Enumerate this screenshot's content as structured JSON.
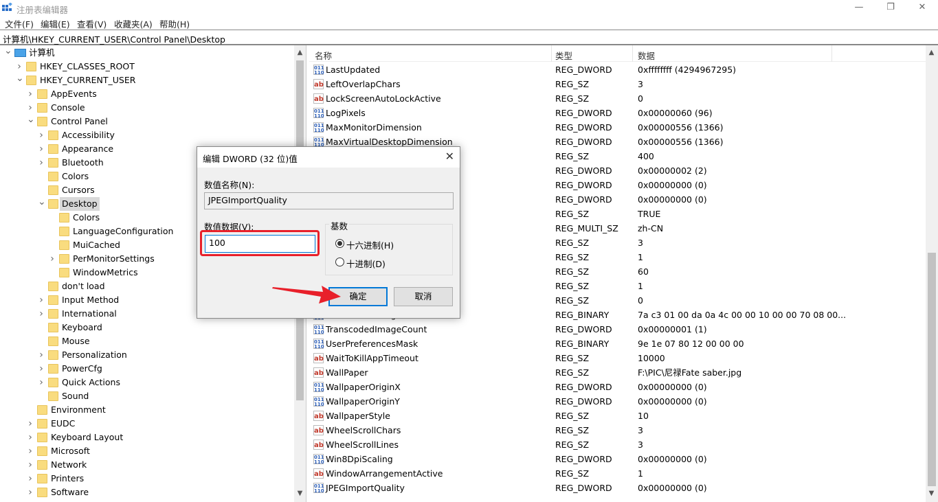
{
  "window": {
    "title": "注册表编辑器",
    "minimize": "—",
    "restore": "❐",
    "close": "✕"
  },
  "menu": [
    "文件(F)",
    "编辑(E)",
    "查看(V)",
    "收藏夹(A)",
    "帮助(H)"
  ],
  "address": "计算机\\HKEY_CURRENT_USER\\Control Panel\\Desktop",
  "tree": [
    {
      "label": "计算机",
      "level": 0,
      "state": "expanded",
      "icon": "computer-icon"
    },
    {
      "label": "HKEY_CLASSES_ROOT",
      "level": 1,
      "state": "collapsed"
    },
    {
      "label": "HKEY_CURRENT_USER",
      "level": 1,
      "state": "expanded"
    },
    {
      "label": "AppEvents",
      "level": 2,
      "state": "collapsed"
    },
    {
      "label": "Console",
      "level": 2,
      "state": "collapsed"
    },
    {
      "label": "Control Panel",
      "level": 2,
      "state": "expanded"
    },
    {
      "label": "Accessibility",
      "level": 3,
      "state": "collapsed"
    },
    {
      "label": "Appearance",
      "level": 3,
      "state": "collapsed"
    },
    {
      "label": "Bluetooth",
      "level": 3,
      "state": "collapsed"
    },
    {
      "label": "Colors",
      "level": 3,
      "state": "none"
    },
    {
      "label": "Cursors",
      "level": 3,
      "state": "none"
    },
    {
      "label": "Desktop",
      "level": 3,
      "state": "expanded",
      "selected": true
    },
    {
      "label": "Colors",
      "level": 4,
      "state": "none"
    },
    {
      "label": "LanguageConfiguration",
      "level": 4,
      "state": "none"
    },
    {
      "label": "MuiCached",
      "level": 4,
      "state": "none"
    },
    {
      "label": "PerMonitorSettings",
      "level": 4,
      "state": "collapsed"
    },
    {
      "label": "WindowMetrics",
      "level": 4,
      "state": "none"
    },
    {
      "label": "don't load",
      "level": 3,
      "state": "none"
    },
    {
      "label": "Input Method",
      "level": 3,
      "state": "collapsed"
    },
    {
      "label": "International",
      "level": 3,
      "state": "collapsed"
    },
    {
      "label": "Keyboard",
      "level": 3,
      "state": "none"
    },
    {
      "label": "Mouse",
      "level": 3,
      "state": "none"
    },
    {
      "label": "Personalization",
      "level": 3,
      "state": "collapsed"
    },
    {
      "label": "PowerCfg",
      "level": 3,
      "state": "collapsed"
    },
    {
      "label": "Quick Actions",
      "level": 3,
      "state": "collapsed"
    },
    {
      "label": "Sound",
      "level": 3,
      "state": "none"
    },
    {
      "label": "Environment",
      "level": 2,
      "state": "none"
    },
    {
      "label": "EUDC",
      "level": 2,
      "state": "collapsed"
    },
    {
      "label": "Keyboard Layout",
      "level": 2,
      "state": "collapsed"
    },
    {
      "label": "Microsoft",
      "level": 2,
      "state": "collapsed"
    },
    {
      "label": "Network",
      "level": 2,
      "state": "collapsed"
    },
    {
      "label": "Printers",
      "level": 2,
      "state": "collapsed"
    },
    {
      "label": "Software",
      "level": 2,
      "state": "collapsed"
    }
  ],
  "list": {
    "columns": [
      "名称",
      "类型",
      "数据"
    ],
    "rows": [
      {
        "name": "LastUpdated",
        "type": "REG_DWORD",
        "data": "0xffffffff (4294967295)"
      },
      {
        "name": "LeftOverlapChars",
        "type": "REG_SZ",
        "data": "3"
      },
      {
        "name": "LockScreenAutoLockActive",
        "type": "REG_SZ",
        "data": "0"
      },
      {
        "name": "LogPixels",
        "type": "REG_DWORD",
        "data": "0x00000060 (96)"
      },
      {
        "name": "MaxMonitorDimension",
        "type": "REG_DWORD",
        "data": "0x00000556 (1366)"
      },
      {
        "name": "MaxVirtualDesktopDimension",
        "type": "REG_DWORD",
        "data": "0x00000556 (1366)"
      },
      {
        "name": "",
        "type": "REG_SZ",
        "data": "400"
      },
      {
        "name": "",
        "type": "REG_DWORD",
        "data": "0x00000002 (2)"
      },
      {
        "name": "",
        "type": "REG_DWORD",
        "data": "0x00000000 (0)"
      },
      {
        "name": "",
        "type": "REG_DWORD",
        "data": "0x00000000 (0)"
      },
      {
        "name": "",
        "type": "REG_SZ",
        "data": "TRUE"
      },
      {
        "name": "",
        "type": "REG_MULTI_SZ",
        "data": "zh-CN"
      },
      {
        "name": "",
        "type": "REG_SZ",
        "data": "3"
      },
      {
        "name": "",
        "type": "REG_SZ",
        "data": "1"
      },
      {
        "name": "",
        "type": "REG_SZ",
        "data": "60"
      },
      {
        "name": "",
        "type": "REG_SZ",
        "data": "1"
      },
      {
        "name": "",
        "type": "REG_SZ",
        "data": "0"
      },
      {
        "name": "TranscodedImageCache",
        "type": "REG_BINARY",
        "data": "7a c3 01 00 da 0a 4c 00 00 10 00 00 70 08 00..."
      },
      {
        "name": "TranscodedImageCount",
        "type": "REG_DWORD",
        "data": "0x00000001 (1)"
      },
      {
        "name": "UserPreferencesMask",
        "type": "REG_BINARY",
        "data": "9e 1e 07 80 12 00 00 00"
      },
      {
        "name": "WaitToKillAppTimeout",
        "type": "REG_SZ",
        "data": "10000"
      },
      {
        "name": "WallPaper",
        "type": "REG_SZ",
        "data": "F:\\PIC\\尼禄Fate saber.jpg"
      },
      {
        "name": "WallpaperOriginX",
        "type": "REG_DWORD",
        "data": "0x00000000 (0)"
      },
      {
        "name": "WallpaperOriginY",
        "type": "REG_DWORD",
        "data": "0x00000000 (0)"
      },
      {
        "name": "WallpaperStyle",
        "type": "REG_SZ",
        "data": "10"
      },
      {
        "name": "WheelScrollChars",
        "type": "REG_SZ",
        "data": "3"
      },
      {
        "name": "WheelScrollLines",
        "type": "REG_SZ",
        "data": "3"
      },
      {
        "name": "Win8DpiScaling",
        "type": "REG_DWORD",
        "data": "0x00000000 (0)"
      },
      {
        "name": "WindowArrangementActive",
        "type": "REG_SZ",
        "data": "1"
      },
      {
        "name": "JPEGImportQuality",
        "type": "REG_DWORD",
        "data": "0x00000000 (0)"
      }
    ]
  },
  "dialog": {
    "title": "编辑 DWORD (32 位)值",
    "name_label": "数值名称(N):",
    "name_value": "JPEGImportQuality",
    "data_label": "数值数据(V):",
    "data_value": "100",
    "base_label": "基数",
    "hex_label": "十六进制(H)",
    "dec_label": "十进制(D)",
    "selected_base": "hex",
    "ok": "确定",
    "cancel": "取消",
    "close": "✕"
  },
  "colors": {
    "highlight": "#e8202a",
    "accent": "#0078d7",
    "folder": "#f9dc7f"
  }
}
